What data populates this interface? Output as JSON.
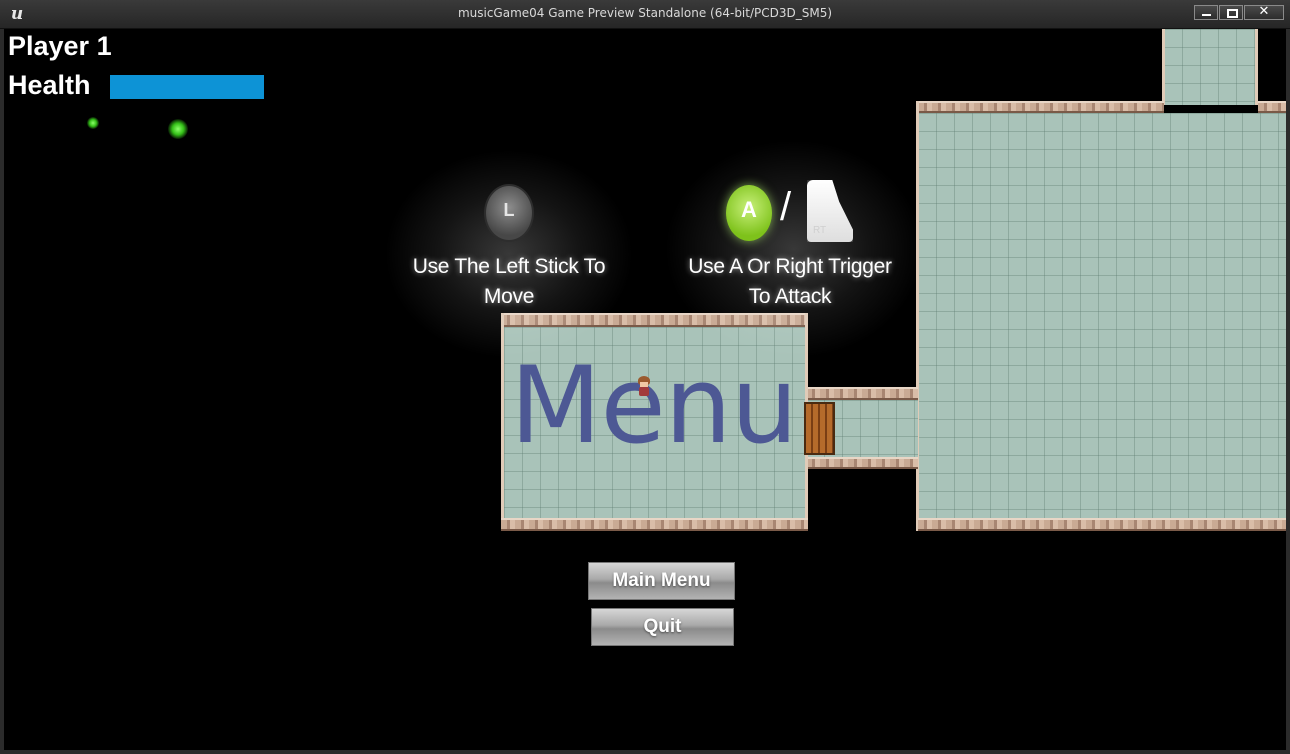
{
  "window": {
    "title": "musicGame04 Game Preview Standalone (64-bit/PCD3D_SM5)",
    "close_glyph": "✕"
  },
  "hud": {
    "player_label": "Player 1",
    "health_label": "Health",
    "health_fraction": 1.0,
    "health_color": "#0d93d6"
  },
  "controls": {
    "move_icon": "left-stick-icon",
    "move_icon_text": "L",
    "move_hint": "Use The Left Stick To Move",
    "attack_icon_a": "a-button-icon",
    "attack_icon_a_text": "A",
    "separator": "/",
    "attack_icon_rt": "right-trigger-icon",
    "attack_icon_rt_text": "RT",
    "attack_hint": "Use A Or Right Trigger To Attack"
  },
  "world": {
    "floor_label": "Menu",
    "floor_label_color": "#4d5894"
  },
  "menu": {
    "main_menu_label": "Main Menu",
    "quit_label": "Quit"
  }
}
